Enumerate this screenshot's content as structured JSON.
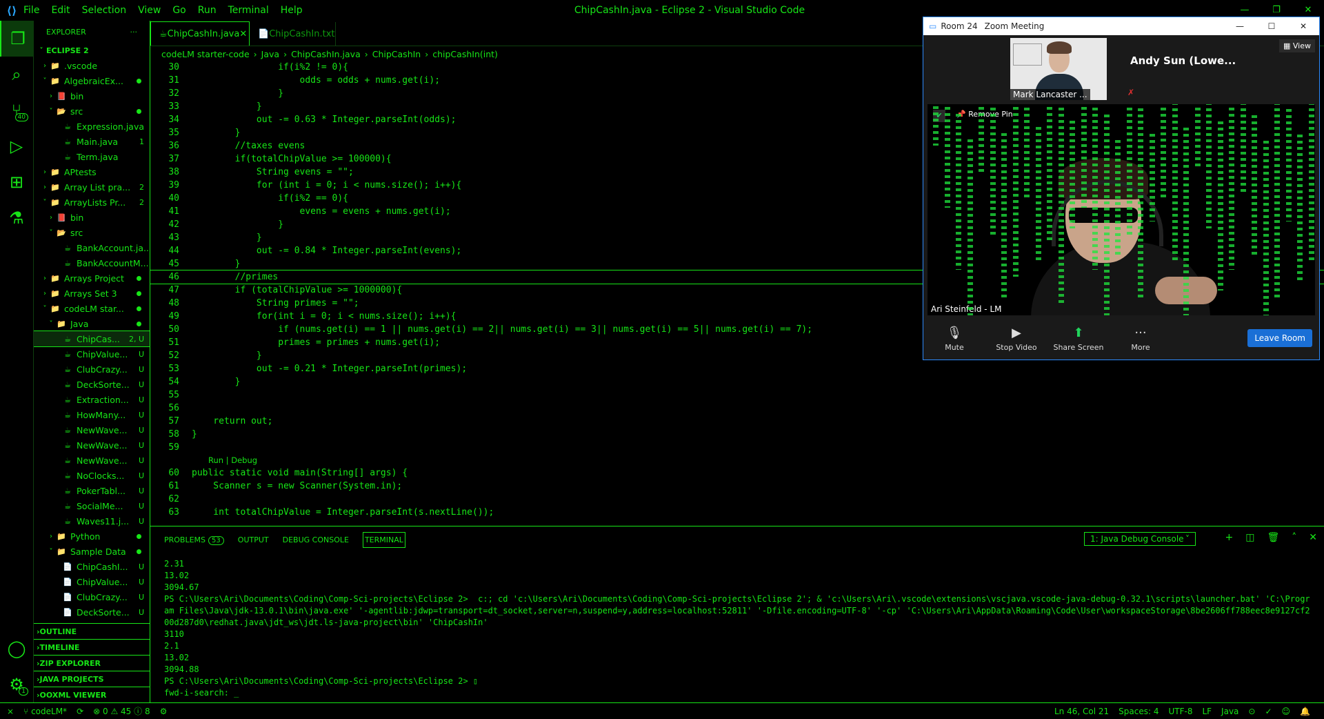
{
  "window": {
    "title": "ChipCashIn.java - Eclipse 2 - Visual Studio Code",
    "menu": [
      "File",
      "Edit",
      "Selection",
      "View",
      "Go",
      "Run",
      "Terminal",
      "Help"
    ]
  },
  "activity": {
    "scm_badge": "40",
    "settings_badge": "1"
  },
  "sidebar": {
    "title": "EXPLORER",
    "more": "···",
    "root": "ECLIPSE 2",
    "items": [
      {
        "depth": 1,
        "chev": "›",
        "icon": "folder",
        "label": ".vscode",
        "status": ""
      },
      {
        "depth": 1,
        "chev": "˅",
        "icon": "folder",
        "label": "AlgebraicEx...",
        "status": "dot"
      },
      {
        "depth": 2,
        "chev": "›",
        "icon": "bin",
        "label": "bin",
        "status": ""
      },
      {
        "depth": 2,
        "chev": "˅",
        "icon": "src",
        "label": "src",
        "status": "dot"
      },
      {
        "depth": 3,
        "chev": "",
        "icon": "java",
        "label": "Expression.java",
        "status": ""
      },
      {
        "depth": 3,
        "chev": "",
        "icon": "java",
        "label": "Main.java",
        "status": "1"
      },
      {
        "depth": 3,
        "chev": "",
        "icon": "java",
        "label": "Term.java",
        "status": ""
      },
      {
        "depth": 1,
        "chev": "›",
        "icon": "folder",
        "label": "APtests",
        "status": ""
      },
      {
        "depth": 1,
        "chev": "›",
        "icon": "folder",
        "label": "Array List pra...",
        "status": "2"
      },
      {
        "depth": 1,
        "chev": "˅",
        "icon": "folder",
        "label": "ArrayLists Pr...",
        "status": "2"
      },
      {
        "depth": 2,
        "chev": "›",
        "icon": "bin",
        "label": "bin",
        "status": ""
      },
      {
        "depth": 2,
        "chev": "˅",
        "icon": "src",
        "label": "src",
        "status": ""
      },
      {
        "depth": 3,
        "chev": "",
        "icon": "java",
        "label": "BankAccount.ja...",
        "status": ""
      },
      {
        "depth": 3,
        "chev": "",
        "icon": "java",
        "label": "BankAccountM...",
        "status": ""
      },
      {
        "depth": 1,
        "chev": "›",
        "icon": "folder",
        "label": "Arrays Project",
        "status": "dot"
      },
      {
        "depth": 1,
        "chev": "›",
        "icon": "folder",
        "label": "Arrays Set 3",
        "status": "dot"
      },
      {
        "depth": 1,
        "chev": "˅",
        "icon": "folder",
        "label": "codeLM star...",
        "status": "dot"
      },
      {
        "depth": 2,
        "chev": "˅",
        "icon": "folder",
        "label": "Java",
        "status": "dot"
      },
      {
        "depth": 3,
        "chev": "",
        "icon": "java",
        "label": "ChipCas...",
        "status": "2, U",
        "selected": true
      },
      {
        "depth": 3,
        "chev": "",
        "icon": "java",
        "label": "ChipValue...",
        "status": "U"
      },
      {
        "depth": 3,
        "chev": "",
        "icon": "java",
        "label": "ClubCrazy...",
        "status": "U"
      },
      {
        "depth": 3,
        "chev": "",
        "icon": "java",
        "label": "DeckSorte...",
        "status": "U"
      },
      {
        "depth": 3,
        "chev": "",
        "icon": "java",
        "label": "Extraction...",
        "status": "U"
      },
      {
        "depth": 3,
        "chev": "",
        "icon": "java",
        "label": "HowMany...",
        "status": "U"
      },
      {
        "depth": 3,
        "chev": "",
        "icon": "java",
        "label": "NewWave...",
        "status": "U"
      },
      {
        "depth": 3,
        "chev": "",
        "icon": "java",
        "label": "NewWave...",
        "status": "U"
      },
      {
        "depth": 3,
        "chev": "",
        "icon": "java",
        "label": "NewWave...",
        "status": "U"
      },
      {
        "depth": 3,
        "chev": "",
        "icon": "java",
        "label": "NoClocks...",
        "status": "U"
      },
      {
        "depth": 3,
        "chev": "",
        "icon": "java",
        "label": "PokerTabl...",
        "status": "U"
      },
      {
        "depth": 3,
        "chev": "",
        "icon": "java",
        "label": "SocialMe...",
        "status": "U"
      },
      {
        "depth": 3,
        "chev": "",
        "icon": "java",
        "label": "Waves11.j...",
        "status": "U"
      },
      {
        "depth": 2,
        "chev": "›",
        "icon": "folder",
        "label": "Python",
        "status": "dot"
      },
      {
        "depth": 2,
        "chev": "˅",
        "icon": "folder",
        "label": "Sample Data",
        "status": "dot"
      },
      {
        "depth": 3,
        "chev": "",
        "icon": "txt",
        "label": "ChipCashI...",
        "status": "U"
      },
      {
        "depth": 3,
        "chev": "",
        "icon": "txt",
        "label": "ChipValue...",
        "status": "U"
      },
      {
        "depth": 3,
        "chev": "",
        "icon": "txt",
        "label": "ClubCrazy...",
        "status": "U"
      },
      {
        "depth": 3,
        "chev": "",
        "icon": "txt",
        "label": "DeckSorte...",
        "status": "U"
      }
    ],
    "sections": [
      "OUTLINE",
      "TIMELINE",
      "ZIP EXPLORER",
      "JAVA PROJECTS",
      "OOXML VIEWER"
    ]
  },
  "editor": {
    "tabs": [
      {
        "label": "ChipCashIn.java",
        "active": true
      },
      {
        "label": "ChipCashIn.txt",
        "active": false
      }
    ],
    "breadcrumbs": [
      "codeLM starter-code",
      "Java",
      "ChipCashIn.java",
      "ChipCashIn",
      "chipCashIn(int)"
    ],
    "lines": [
      {
        "n": "30",
        "t": "                if(i%2 != 0){"
      },
      {
        "n": "31",
        "t": "                    odds = odds + nums.get(i);"
      },
      {
        "n": "32",
        "t": "                }"
      },
      {
        "n": "33",
        "t": "            }"
      },
      {
        "n": "34",
        "t": "            out -= 0.63 * Integer.parseInt(odds);"
      },
      {
        "n": "35",
        "t": "        }"
      },
      {
        "n": "36",
        "t": "        //taxes evens"
      },
      {
        "n": "37",
        "t": "        if(totalChipValue >= 100000){"
      },
      {
        "n": "38",
        "t": "            String evens = \"\";"
      },
      {
        "n": "39",
        "t": "            for (int i = 0; i < nums.size(); i++){"
      },
      {
        "n": "40",
        "t": "                if(i%2 == 0){"
      },
      {
        "n": "41",
        "t": "                    evens = evens + nums.get(i);"
      },
      {
        "n": "42",
        "t": "                }"
      },
      {
        "n": "43",
        "t": "            }"
      },
      {
        "n": "44",
        "t": "            out -= 0.84 * Integer.parseInt(evens);"
      },
      {
        "n": "45",
        "t": "        }"
      },
      {
        "n": "46",
        "t": "        //primes",
        "current": true
      },
      {
        "n": "47",
        "t": "        if (totalChipValue >= 1000000){"
      },
      {
        "n": "48",
        "t": "            String primes = \"\";"
      },
      {
        "n": "49",
        "t": "            for(int i = 0; i < nums.size(); i++){"
      },
      {
        "n": "50",
        "t": "                if (nums.get(i) == 1 || nums.get(i) == 2|| nums.get(i) == 3|| nums.get(i) == 5|| nums.get(i) == 7);"
      },
      {
        "n": "51",
        "t": "                primes = primes + nums.get(i);"
      },
      {
        "n": "52",
        "t": "            }"
      },
      {
        "n": "53",
        "t": "            out -= 0.21 * Integer.parseInt(primes);"
      },
      {
        "n": "54",
        "t": "        }"
      },
      {
        "n": "55",
        "t": ""
      },
      {
        "n": "56",
        "t": ""
      },
      {
        "n": "57",
        "t": "    return out;"
      },
      {
        "n": "58",
        "t": "}"
      },
      {
        "n": "59",
        "t": ""
      },
      {
        "n": "",
        "t": "Run | Debug",
        "lens": true
      },
      {
        "n": "60",
        "t": "public static void main(String[] args) {"
      },
      {
        "n": "61",
        "t": "    Scanner s = new Scanner(System.in);"
      },
      {
        "n": "62",
        "t": ""
      },
      {
        "n": "63",
        "t": "    int totalChipValue = Integer.parseInt(s.nextLine());"
      }
    ]
  },
  "panel": {
    "tabs": [
      {
        "label": "PROBLEMS",
        "count": "53"
      },
      {
        "label": "OUTPUT"
      },
      {
        "label": "DEBUG CONSOLE"
      },
      {
        "label": "TERMINAL",
        "active": true
      }
    ],
    "terminal_select": "1: Java Debug Console",
    "terminal_lines": [
      "2.31",
      "13.02",
      "3094.67",
      "PS C:\\Users\\Ari\\Documents\\Coding\\Comp-Sci-projects\\Eclipse 2>  c:; cd 'c:\\Users\\Ari\\Documents\\Coding\\Comp-Sci-projects\\Eclipse 2'; & 'c:\\Users\\Ari\\.vscode\\extensions\\vscjava.vscode-java-debug-0.32.1\\scripts\\launcher.bat' 'C:\\Program Files\\Java\\jdk-13.0.1\\bin\\java.exe' '-agentlib:jdwp=transport=dt_socket,server=n,suspend=y,address=localhost:52811' '-Dfile.encoding=UTF-8' '-cp' 'C:\\Users\\Ari\\AppData\\Roaming\\Code\\User\\workspaceStorage\\8be2606ff788eec8e9127cf200d287d0\\redhat.java\\jdt_ws\\jdt.ls-java-project\\bin' 'ChipCashIn'",
      "3110",
      "2.1",
      "13.02",
      "3094.88",
      "PS C:\\Users\\Ari\\Documents\\Coding\\Comp-Sci-projects\\Eclipse 2> ▯",
      "fwd-i-search: _"
    ]
  },
  "status": {
    "branch": "codeLM*",
    "errors": "0",
    "warnings": "45",
    "info": "8",
    "position": "Ln 46, Col 21",
    "spaces": "Spaces: 4",
    "encoding": "UTF-8",
    "eol": "LF",
    "language": "Java"
  },
  "zoom": {
    "title": "Room 24",
    "app": "Zoom Meeting",
    "view": "View",
    "thumb_name": "Mark Lancaster ...",
    "other_name": "Andy Sun (Lowe...",
    "remove_pin": "Remove Pin",
    "video_name": "Ari Steinfeld - LM",
    "controls": [
      "Mute",
      "Stop Video",
      "Share Screen",
      "More"
    ],
    "leave": "Leave Room",
    "share_color": "#21d35c",
    "leave_color": "#1a6fd6"
  },
  "theme": {
    "accent": "#17e617",
    "background": "#000000"
  }
}
